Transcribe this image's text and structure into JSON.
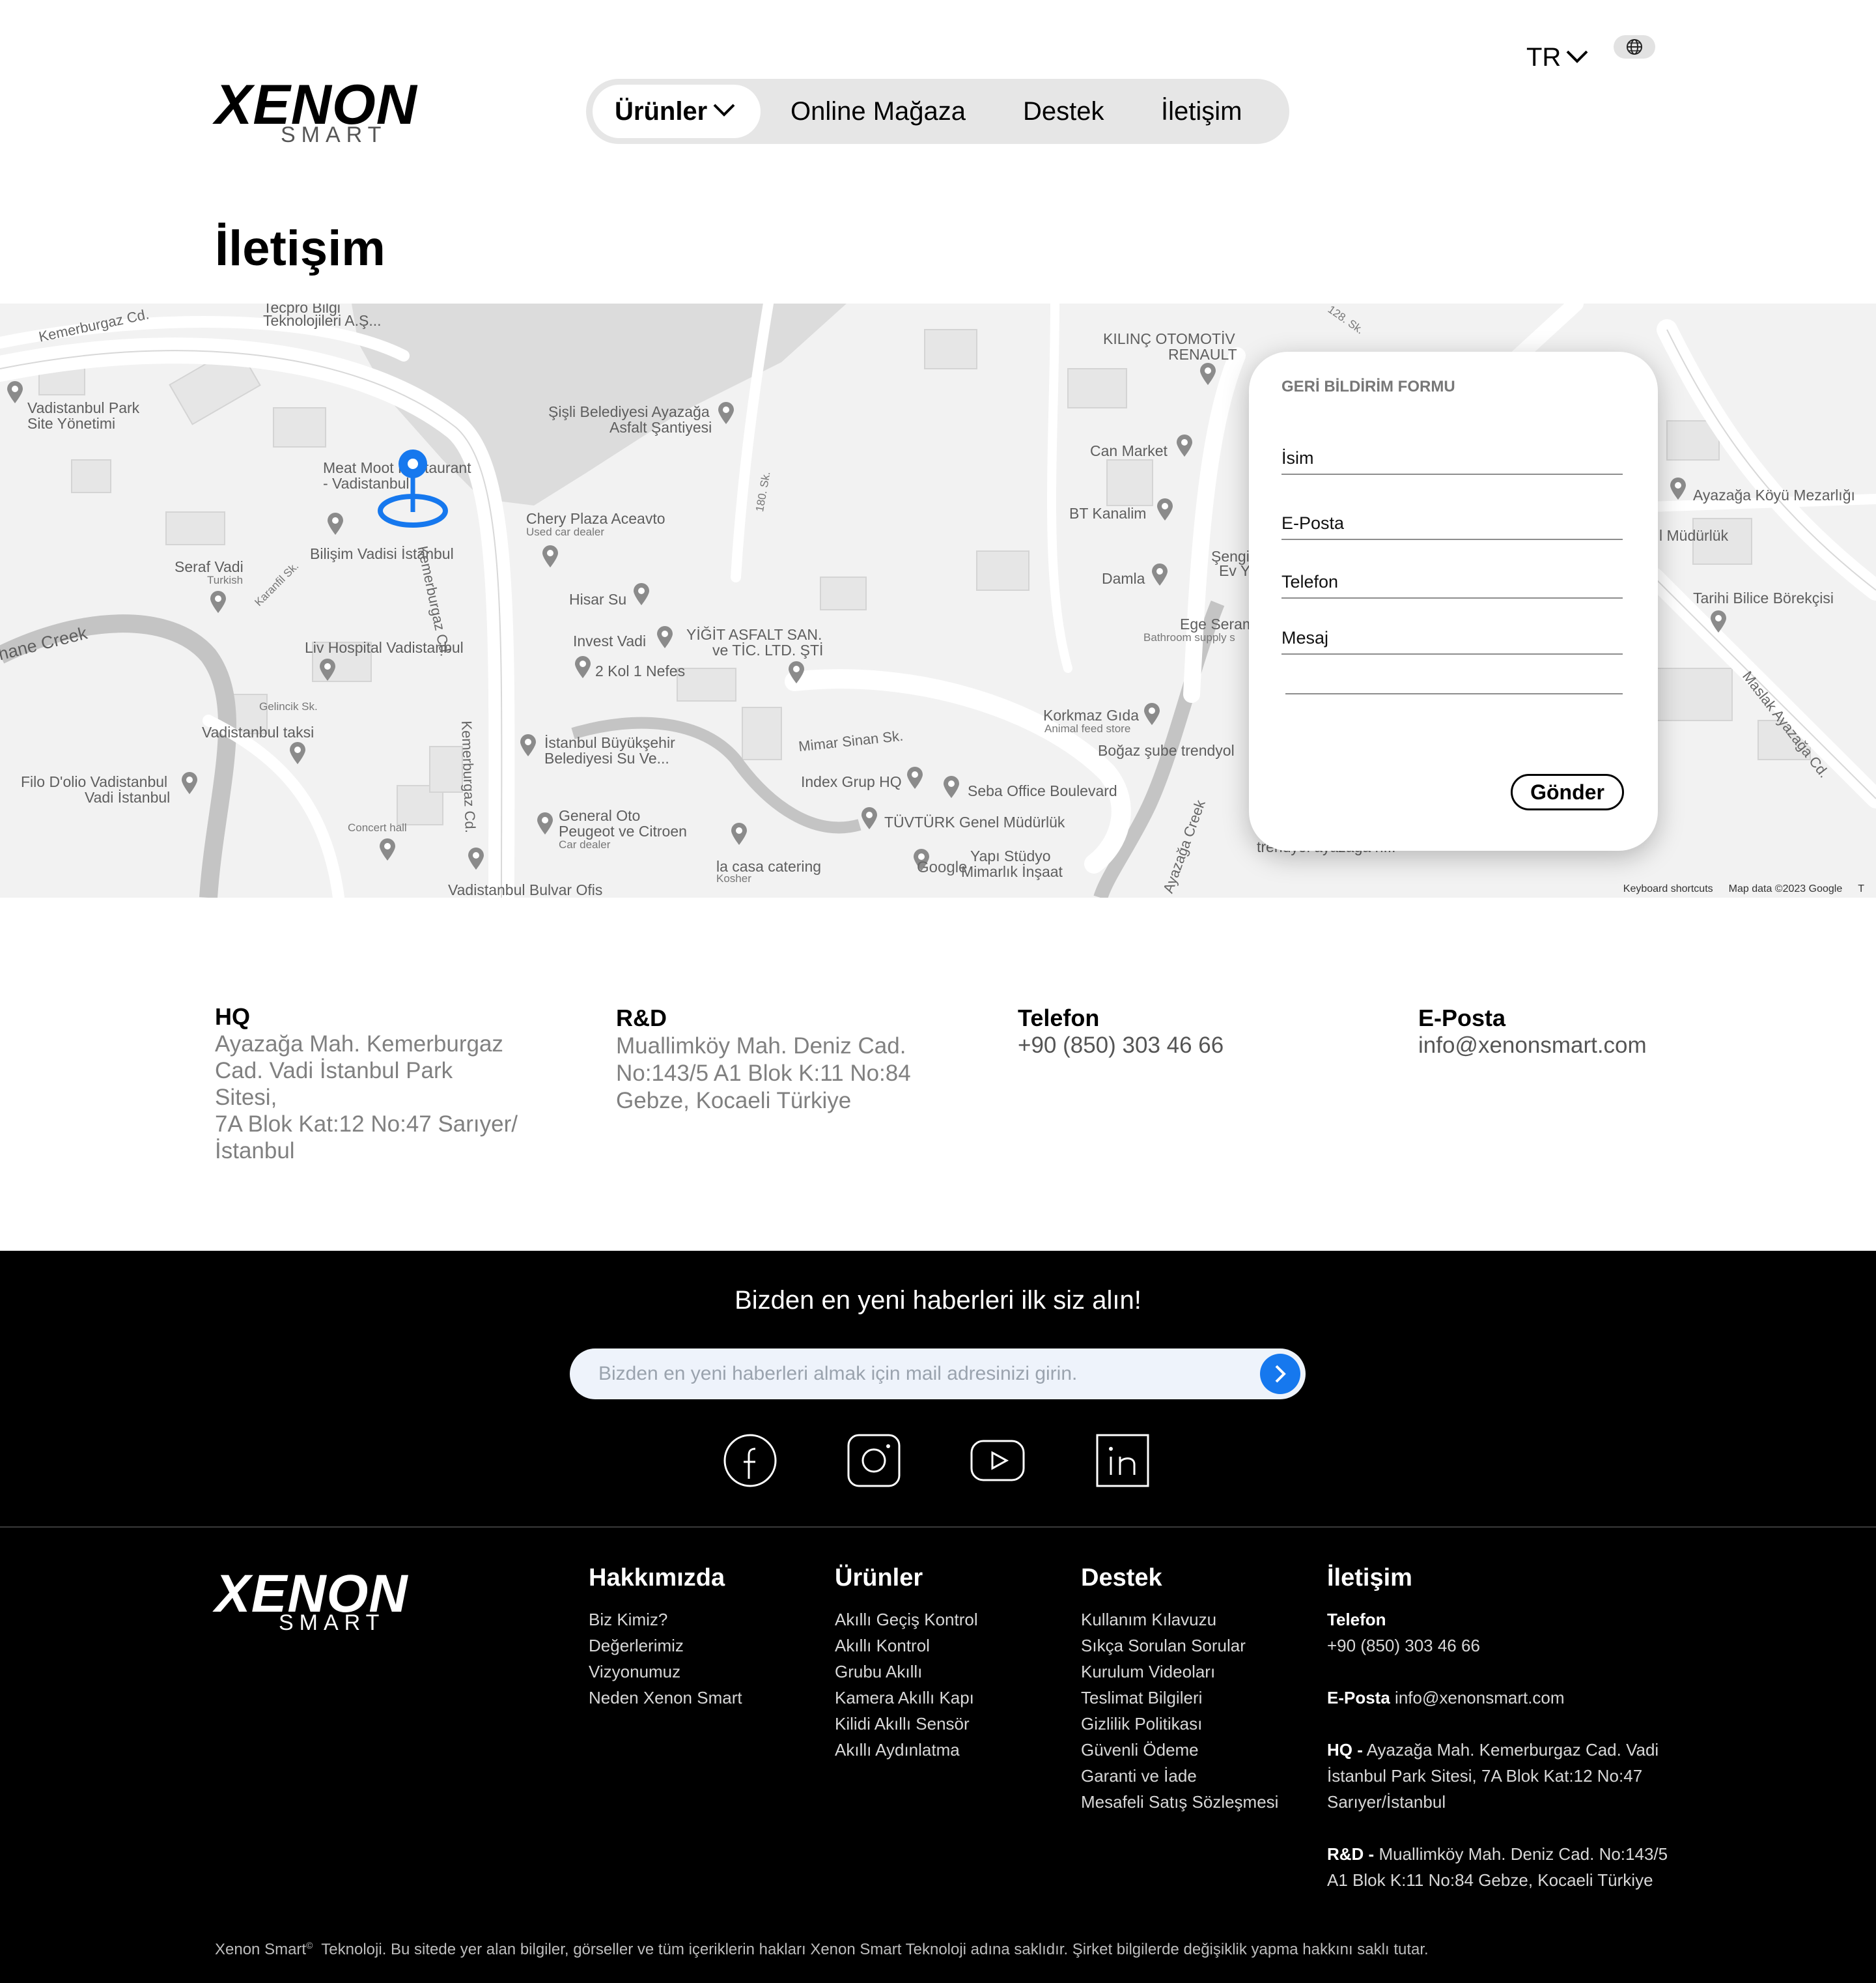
{
  "header": {
    "logo_word": "XENON",
    "logo_sub": "SMART",
    "nav": [
      {
        "label": "Ürünler"
      },
      {
        "label": "Online Mağaza"
      },
      {
        "label": "Destek"
      },
      {
        "label": "İletişim"
      }
    ],
    "language": "TR"
  },
  "page_title": "İletişim",
  "map": {
    "labels": {
      "kemerburgaz_cd": "Kemerburgaz Cd.",
      "tecpro": "Tecpro Bilgi",
      "tecpro2": "Teknolojileri A.Ş...",
      "vadistanbul_park": "Vadistanbul Park",
      "site_yonetimi": "Site Yönetimi",
      "meat_moot": "Meat Moot Restaurant",
      "meat_moot2": "- Vadistanbul",
      "bilisim": "Bilişim Vadisi İstanbul",
      "seraf": "Seraf Vadi",
      "turkish": "Turkish",
      "karanfil": "Karanfil Sk.",
      "sisli": "Şişli Belediyesi Ayazağa",
      "asfalt": "Asfalt Şantiyesi",
      "chery": "Chery Plaza Aceavto",
      "used_car": "Used car dealer",
      "hisar": "Hisar Su",
      "invest": "Invest Vadi",
      "yigit": "YİĞİT ASFALT SAN.",
      "yigit2": "ve TİC. LTD. ŞTİ",
      "kol": "2 Kol 1 Nefes",
      "liv": "Liv Hospital Vadistanbul",
      "haneCreek": "hane Creek",
      "gelincik": "Gelincik Sk.",
      "taksi": "Vadistanbul taksi",
      "filo": "Filo D'olio Vadistanbul",
      "vadi_istanbul": "Vadi İstanbul",
      "concert": "Concert hall",
      "ibb": "İstanbul Büyükşehir",
      "ibb2": "Belediyesi Su Ve...",
      "general_oto": "General Oto",
      "peugeot": "Peugeot ve Citroen",
      "car_dealer": "Car dealer",
      "la_casa": "la casa catering",
      "kosher": "Kosher",
      "bulvar": "Vadistanbul Bulvar Ofis",
      "kemerburgaz_v": "Kemerburgaz Cd.",
      "sk180": "180. Sk.",
      "kilinc": "KILINÇ OTOMOTİV",
      "renault": "RENAULT",
      "can_market": "Can Market",
      "bt": "BT Kanalim",
      "damla": "Damla",
      "sengi": "Şengi",
      "ev": "Ev Y",
      "ege": "Ege Seram",
      "bathroom": "Bathroom supply s",
      "korkmaz": "Korkmaz Gıda",
      "animal": "Animal feed store",
      "bogaz": "Boğaz şube trendyol",
      "mimar": "Mimar Sinan Sk.",
      "index": "Index Grup HQ",
      "seba": "Seba Office Boulevard",
      "tuvturk": "TÜVTÜRK Genel Müdürlük",
      "yapi": "Yapı Stüdyo",
      "yapi2": "Mimarlık İnşaat",
      "ayazaga_creek": "Ayazağa Creek",
      "trendyol": "trendyol ayazağa h...",
      "mezarligi": "Ayazağa Köyü Mezarlığı",
      "mudurluk": "l Müdürlük",
      "tarihi": "Tarihi Bilice Börekçisi",
      "maslak": "Maslak Ayazağa Cd.",
      "sk128": "128. Sk.",
      "google": "Google",
      "keyboard": "Keyboard shortcuts",
      "map_data": "Map data ©2023 Google",
      "terms": "T"
    }
  },
  "form": {
    "title": "GERİ BİLDİRİM FORMU",
    "name": "İsim",
    "email": "E-Posta",
    "phone": "Telefon",
    "message": "Mesaj",
    "submit": "Gönder"
  },
  "contact": {
    "hq_title": "HQ",
    "hq_lines": [
      "Ayazağa Mah. Kemerburgaz",
      "Cad. Vadi İstanbul Park Sitesi,",
      "7A Blok  Kat:12 No:47 Sarıyer/",
      "İstanbul"
    ],
    "rd_title": "R&D",
    "rd_lines": [
      "Muallimköy Mah. Deniz Cad.",
      "No:143/5 A1 Blok K:11 No:84",
      "Gebze, Kocaeli Türkiye"
    ],
    "phone_title": "Telefon",
    "phone": "+90 (850) 303 46 66",
    "email_title": "E-Posta",
    "email": "info@xenonsmart.com"
  },
  "footer": {
    "newsletter_title": "Bizden en yeni haberleri ilk siz alın!",
    "newsletter_placeholder": "Bizden en yeni haberleri almak için mail adresinizi girin.",
    "columns": {
      "about": {
        "title": "Hakkımızda",
        "items": [
          "Biz Kimiz?",
          "Değerlerimiz",
          "Vizyonumuz",
          "Neden Xenon Smart"
        ]
      },
      "products": {
        "title": "Ürünler",
        "items": [
          "Akıllı Geçiş Kontrol",
          "Akıllı Kontrol",
          "Grubu Akıllı",
          "Kamera Akıllı Kapı",
          "Kilidi Akıllı Sensör",
          "Akıllı Aydınlatma"
        ]
      },
      "support": {
        "title": "Destek",
        "items": [
          "Kullanım Kılavuzu",
          "Sıkça Sorulan Sorular",
          "Kurulum Videoları",
          "Teslimat Bilgileri",
          "Gizlilik Politikası",
          "Güvenli Ödeme",
          "Garanti ve İade",
          "Mesafeli Satış Sözleşmesi"
        ]
      },
      "contact": {
        "title": "İletişim",
        "phone_label": "Telefon",
        "phone": "+90 (850) 303 46 66",
        "email_label": "E-Posta",
        "email": "info@xenonsmart.com",
        "hq_label": "HQ -",
        "hq_line1": "Ayazağa Mah. Kemerburgaz Cad. Vadi",
        "hq_line2": "İstanbul Park Sitesi, 7A Blok  Kat:12 No:47",
        "hq_line3": "Sarıyer/İstanbul",
        "rd_label": "R&D -",
        "rd_line1": "Muallimköy Mah. Deniz Cad. No:143/5",
        "rd_line2": "A1 Blok K:11 No:84  Gebze, Kocaeli Türkiye"
      }
    },
    "copyright_brand": "Xenon Smart",
    "copyright_mark": "©",
    "copyright_text": "  Teknoloji. Bu sitede yer alan bilgiler, görseller ve tüm içeriklerin hakları Xenon Smart Teknoloji adına saklıdır. Şirket bilgilerde değişiklik yapma hakkını saklı tutar."
  },
  "colors": {
    "accent": "#1678ee",
    "footer_bg": "#000000",
    "nav_bg": "#e6e6e6",
    "muted_text": "#808080"
  },
  "icons": [
    "chevron-down-icon",
    "globe-icon",
    "location-pin-icon",
    "arrow-right-icon",
    "facebook-icon",
    "instagram-icon",
    "youtube-icon",
    "linkedin-icon"
  ]
}
